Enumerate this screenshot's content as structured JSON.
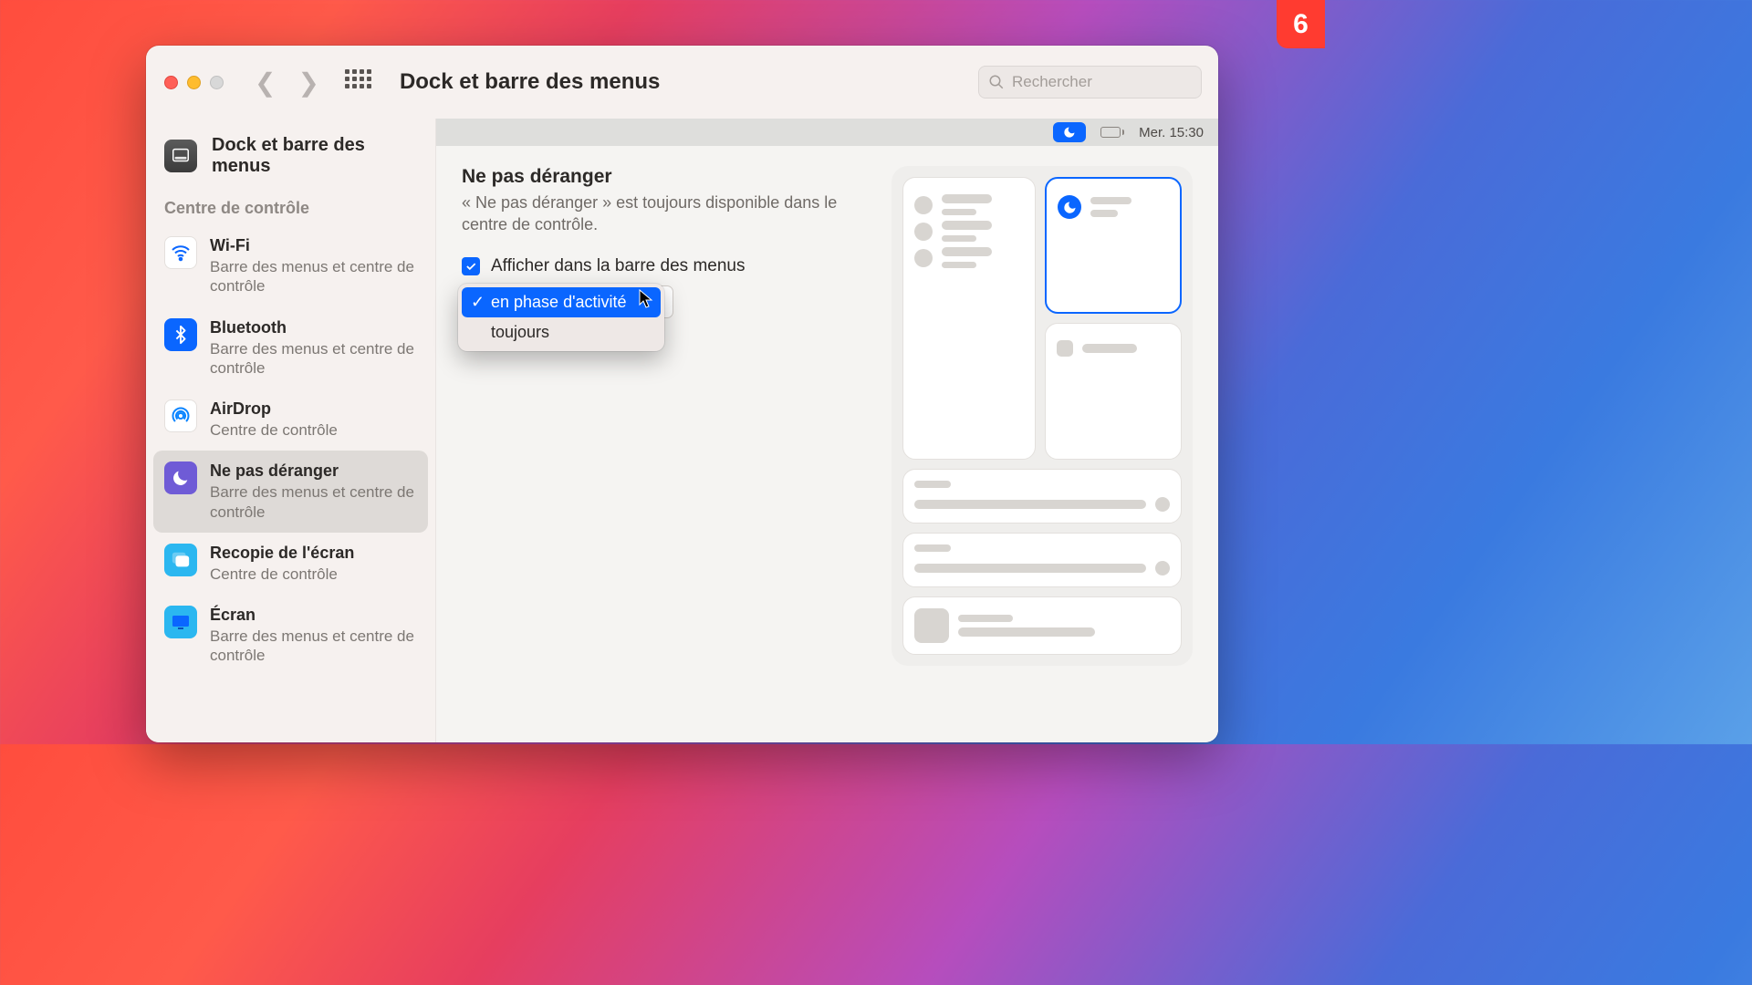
{
  "badge": "6",
  "toolbar": {
    "title": "Dock et barre des menus",
    "search_placeholder": "Rechercher"
  },
  "sidebar": {
    "main_title": "Dock et barre des menus",
    "section_label": "Centre de contrôle",
    "items": [
      {
        "name": "Wi-Fi",
        "sub": "Barre des menus et centre de contrôle",
        "icon": "wifi",
        "selected": false
      },
      {
        "name": "Bluetooth",
        "sub": "Barre des menus et centre de contrôle",
        "icon": "bluetooth",
        "selected": false
      },
      {
        "name": "AirDrop",
        "sub": "Centre de contrôle",
        "icon": "airdrop",
        "selected": false
      },
      {
        "name": "Ne pas déranger",
        "sub": "Barre des menus et centre de contrôle",
        "icon": "moon",
        "selected": true
      },
      {
        "name": "Recopie de l'écran",
        "sub": "Centre de contrôle",
        "icon": "mirror",
        "selected": false
      },
      {
        "name": "Écran",
        "sub": "Barre des menus et centre de contrôle",
        "icon": "display",
        "selected": false
      }
    ]
  },
  "menubar": {
    "time": "Mer. 15:30"
  },
  "pane": {
    "title": "Ne pas déranger",
    "description": "« Ne pas déranger » est toujours disponible dans le centre de contrôle.",
    "checkbox_label": "Afficher dans la barre des menus",
    "checkbox_checked": true,
    "dropdown": {
      "options": [
        {
          "label": "en phase d'activité",
          "selected": true
        },
        {
          "label": "toujours",
          "selected": false
        }
      ]
    }
  }
}
